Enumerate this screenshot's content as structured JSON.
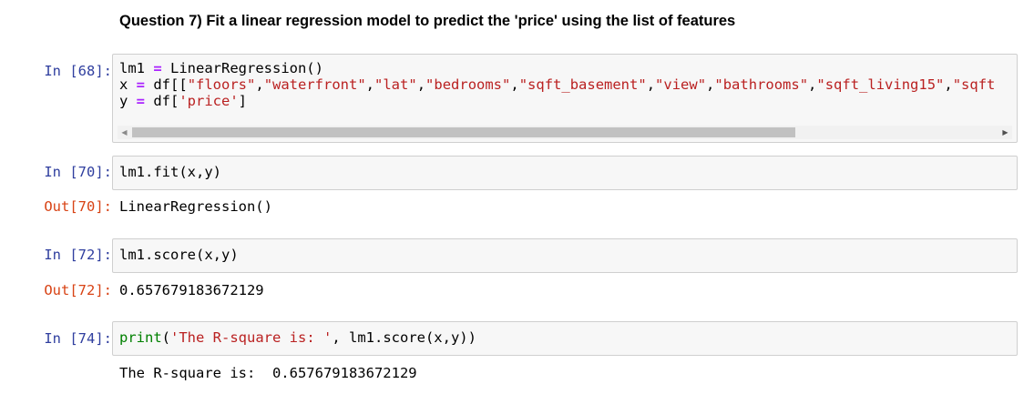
{
  "heading": "Question 7) Fit a linear regression model to predict the 'price' using the list of features",
  "cells": [
    {
      "in_prompt": "In [68]:",
      "code_lines": [
        [
          [
            "lm1 ",
            "txt"
          ],
          [
            "=",
            "op"
          ],
          [
            " LinearRegression()",
            "txt"
          ]
        ],
        [
          [
            "x ",
            "txt"
          ],
          [
            "=",
            "op"
          ],
          [
            " df[[",
            "txt"
          ],
          [
            "\"floors\"",
            "str"
          ],
          [
            ",",
            "txt"
          ],
          [
            "\"waterfront\"",
            "str"
          ],
          [
            ",",
            "txt"
          ],
          [
            "\"lat\"",
            "str"
          ],
          [
            ",",
            "txt"
          ],
          [
            "\"bedrooms\"",
            "str"
          ],
          [
            ",",
            "txt"
          ],
          [
            "\"sqft_basement\"",
            "str"
          ],
          [
            ",",
            "txt"
          ],
          [
            "\"view\"",
            "str"
          ],
          [
            ",",
            "txt"
          ],
          [
            "\"bathrooms\"",
            "str"
          ],
          [
            ",",
            "txt"
          ],
          [
            "\"sqft_living15\"",
            "str"
          ],
          [
            ",",
            "txt"
          ],
          [
            "\"sqft",
            "str"
          ]
        ],
        [
          [
            "y ",
            "txt"
          ],
          [
            "=",
            "op"
          ],
          [
            " df[",
            "txt"
          ],
          [
            "'price'",
            "str"
          ],
          [
            "]",
            "txt"
          ]
        ]
      ]
    },
    {
      "in_prompt": "In [70]:",
      "code_lines": [
        [
          [
            "lm1.fit(x,y)",
            "txt"
          ]
        ]
      ],
      "out_prompt": "Out[70]:",
      "output": "LinearRegression()"
    },
    {
      "in_prompt": "In [72]:",
      "code_lines": [
        [
          [
            "lm1.score(x,y)",
            "txt"
          ]
        ]
      ],
      "out_prompt": "Out[72]:",
      "output": "0.657679183672129"
    },
    {
      "in_prompt": "In [74]:",
      "code_lines": [
        [
          [
            "print",
            "builtin"
          ],
          [
            "(",
            "txt"
          ],
          [
            "'The R-square is: '",
            "str"
          ],
          [
            ", lm1.score(x,y))",
            "txt"
          ]
        ]
      ],
      "output": "The R-square is:  0.657679183672129"
    }
  ],
  "scrollbar": {
    "left_icon": "scroll-left-arrow-icon",
    "right_icon": "scroll-right-arrow-icon"
  }
}
